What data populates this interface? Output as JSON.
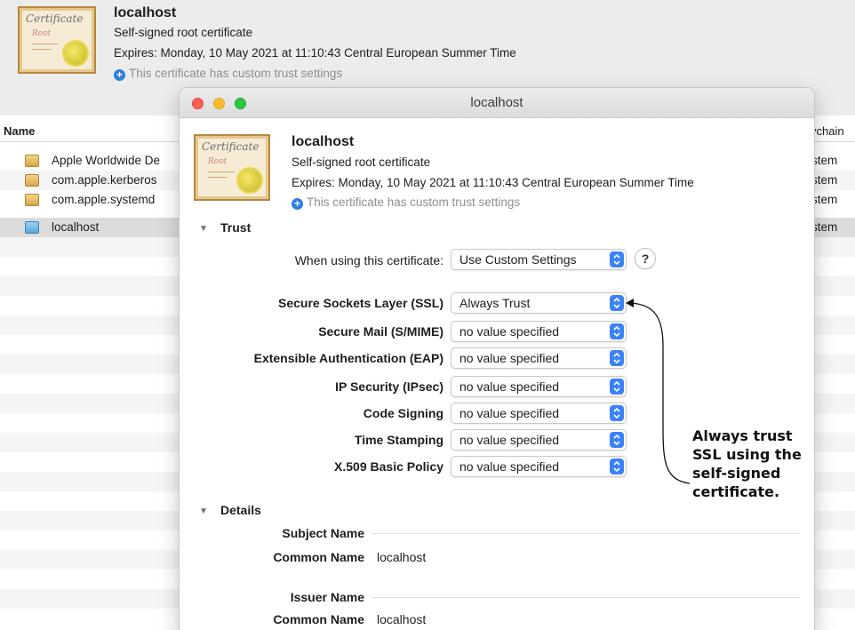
{
  "header": {
    "title": "localhost",
    "type": "Self-signed root certificate",
    "expires": "Expires: Monday, 10 May 2021 at 11:10:43 Central European Summer Time",
    "trust_note": "This certificate has custom trust settings",
    "cert_icon_text": "Certificate",
    "cert_icon_sub": "Root"
  },
  "list": {
    "col_name": "Name",
    "col_keychain": "ychain",
    "rows": [
      {
        "name": "Apple Worldwide De",
        "keychain": "stem"
      },
      {
        "name": "com.apple.kerberos",
        "keychain": "stem"
      },
      {
        "name": "com.apple.systemd",
        "keychain": "stem"
      },
      {
        "name": "localhost",
        "keychain": "stem"
      }
    ]
  },
  "dialog": {
    "window_title": "localhost",
    "cert": {
      "title": "localhost",
      "type": "Self-signed root certificate",
      "expires": "Expires: Monday, 10 May 2021 at 11:10:43 Central European Summer Time",
      "trust_note": "This certificate has custom trust settings"
    },
    "trust": {
      "section_label": "Trust",
      "when_using_label": "When using this certificate:",
      "when_using_value": "Use Custom Settings",
      "help": "?",
      "settings": [
        {
          "label": "Secure Sockets Layer (SSL)",
          "value": "Always Trust"
        },
        {
          "label": "Secure Mail (S/MIME)",
          "value": "no value specified"
        },
        {
          "label": "Extensible Authentication (EAP)",
          "value": "no value specified"
        },
        {
          "label": "IP Security (IPsec)",
          "value": "no value specified"
        },
        {
          "label": "Code Signing",
          "value": "no value specified"
        },
        {
          "label": "Time Stamping",
          "value": "no value specified"
        },
        {
          "label": "X.509 Basic Policy",
          "value": "no value specified"
        }
      ]
    },
    "details": {
      "section_label": "Details",
      "subject_name": "Subject Name",
      "subject_cn_label": "Common Name",
      "subject_cn_value": "localhost",
      "issuer_name": "Issuer Name",
      "issuer_cn_label": "Common Name",
      "issuer_cn_value": "localhost"
    }
  },
  "annotation": {
    "lines": [
      "Always trust",
      "SSL using the",
      "self-signed",
      "certificate."
    ]
  },
  "colors": {
    "accent": "#3b82f7",
    "close": "#fe5f57",
    "minimize": "#febc2e",
    "zoom": "#28c840"
  }
}
